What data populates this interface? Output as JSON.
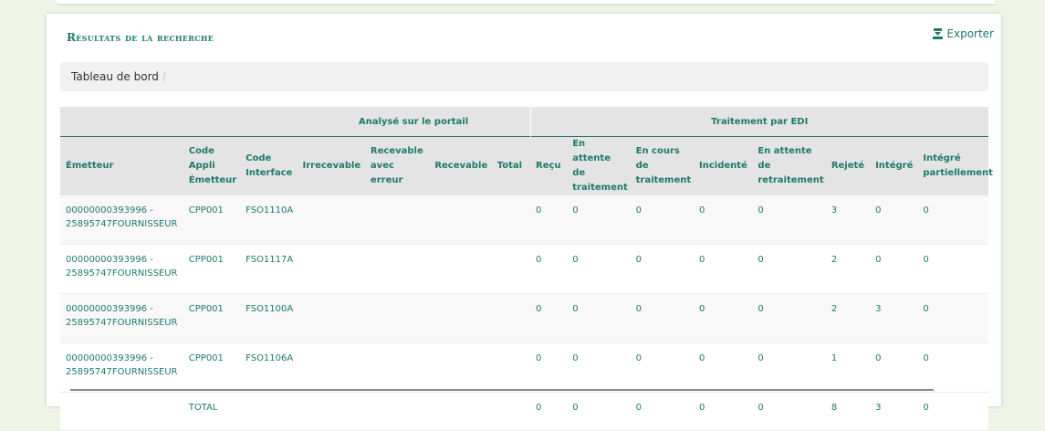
{
  "panel": {
    "title": "Résultats de la recherche",
    "export_label": "Exporter",
    "export_icon": "download-icon"
  },
  "breadcrumb": {
    "item": "Tableau de bord",
    "separator": "/"
  },
  "table": {
    "groups": {
      "portal": "Analysé sur le portail",
      "edi": "Traitement par EDI"
    },
    "columns": [
      "Émetteur",
      "Code Appli Émetteur",
      "Code Interface",
      "Irrecevable",
      "Recevable avec erreur",
      "Recevable",
      "Total",
      "Reçu",
      "En attente de traitement",
      "En cours de traitement",
      "Incidenté",
      "En attente de retraitement",
      "Rejeté",
      "Intégré",
      "Intégré partiellement"
    ],
    "rows": [
      {
        "emetteur": "00000000393996 - 25895747FOURNISSEUR",
        "code_appli": "CPP001",
        "code_interface": "FSO1110A",
        "irrecevable": "",
        "recevable_erreur": "",
        "recevable": "",
        "total": "",
        "recu": "0",
        "attente": "0",
        "en_cours": "0",
        "incidente": "0",
        "attente_retraitement": "0",
        "rejete": "3",
        "integre": "0",
        "integre_partiel": "0"
      },
      {
        "emetteur": "00000000393996 - 25895747FOURNISSEUR",
        "code_appli": "CPP001",
        "code_interface": "FSO1117A",
        "irrecevable": "",
        "recevable_erreur": "",
        "recevable": "",
        "total": "",
        "recu": "0",
        "attente": "0",
        "en_cours": "0",
        "incidente": "0",
        "attente_retraitement": "0",
        "rejete": "2",
        "integre": "0",
        "integre_partiel": "0"
      },
      {
        "emetteur": "00000000393996 - 25895747FOURNISSEUR",
        "code_appli": "CPP001",
        "code_interface": "FSO1100A",
        "irrecevable": "",
        "recevable_erreur": "",
        "recevable": "",
        "total": "",
        "recu": "0",
        "attente": "0",
        "en_cours": "0",
        "incidente": "0",
        "attente_retraitement": "0",
        "rejete": "2",
        "integre": "3",
        "integre_partiel": "0"
      },
      {
        "emetteur": "00000000393996 - 25895747FOURNISSEUR",
        "code_appli": "CPP001",
        "code_interface": "FSO1106A",
        "irrecevable": "",
        "recevable_erreur": "",
        "recevable": "",
        "total": "",
        "recu": "0",
        "attente": "0",
        "en_cours": "0",
        "incidente": "0",
        "attente_retraitement": "0",
        "rejete": "1",
        "integre": "0",
        "integre_partiel": "0"
      }
    ],
    "total_row": {
      "label": "TOTAL",
      "recu": "0",
      "attente": "0",
      "en_cours": "0",
      "incidente": "0",
      "attente_retraitement": "0",
      "rejete": "8",
      "integre": "3",
      "integre_partiel": "0"
    }
  },
  "colors": {
    "accent": "#1f7a6c",
    "background": "#eef5e6"
  }
}
